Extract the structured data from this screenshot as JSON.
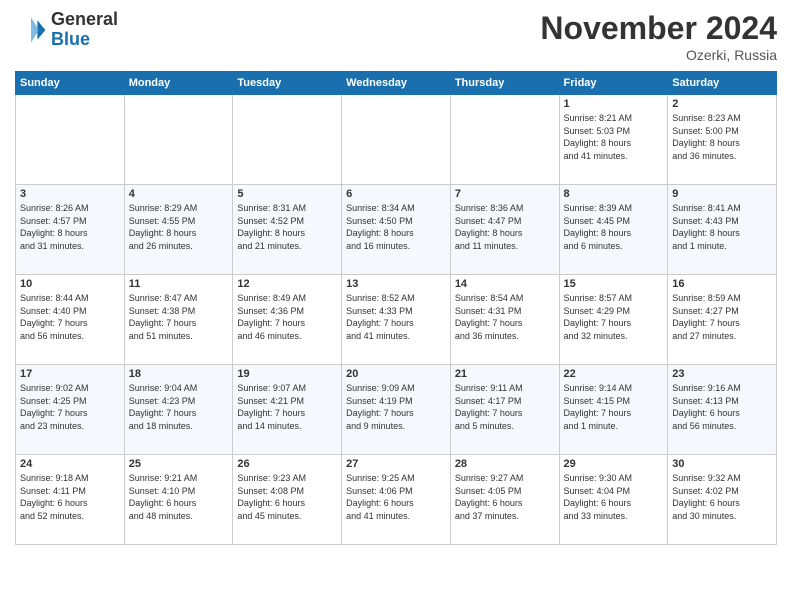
{
  "header": {
    "logo": {
      "general": "General",
      "blue": "Blue"
    },
    "title": "November 2024",
    "location": "Ozerki, Russia"
  },
  "weekdays": [
    "Sunday",
    "Monday",
    "Tuesday",
    "Wednesday",
    "Thursday",
    "Friday",
    "Saturday"
  ],
  "weeks": [
    {
      "days": [
        {
          "num": "",
          "info": ""
        },
        {
          "num": "",
          "info": ""
        },
        {
          "num": "",
          "info": ""
        },
        {
          "num": "",
          "info": ""
        },
        {
          "num": "",
          "info": ""
        },
        {
          "num": "1",
          "info": "Sunrise: 8:21 AM\nSunset: 5:03 PM\nDaylight: 8 hours\nand 41 minutes."
        },
        {
          "num": "2",
          "info": "Sunrise: 8:23 AM\nSunset: 5:00 PM\nDaylight: 8 hours\nand 36 minutes."
        }
      ]
    },
    {
      "days": [
        {
          "num": "3",
          "info": "Sunrise: 8:26 AM\nSunset: 4:57 PM\nDaylight: 8 hours\nand 31 minutes."
        },
        {
          "num": "4",
          "info": "Sunrise: 8:29 AM\nSunset: 4:55 PM\nDaylight: 8 hours\nand 26 minutes."
        },
        {
          "num": "5",
          "info": "Sunrise: 8:31 AM\nSunset: 4:52 PM\nDaylight: 8 hours\nand 21 minutes."
        },
        {
          "num": "6",
          "info": "Sunrise: 8:34 AM\nSunset: 4:50 PM\nDaylight: 8 hours\nand 16 minutes."
        },
        {
          "num": "7",
          "info": "Sunrise: 8:36 AM\nSunset: 4:47 PM\nDaylight: 8 hours\nand 11 minutes."
        },
        {
          "num": "8",
          "info": "Sunrise: 8:39 AM\nSunset: 4:45 PM\nDaylight: 8 hours\nand 6 minutes."
        },
        {
          "num": "9",
          "info": "Sunrise: 8:41 AM\nSunset: 4:43 PM\nDaylight: 8 hours\nand 1 minute."
        }
      ]
    },
    {
      "days": [
        {
          "num": "10",
          "info": "Sunrise: 8:44 AM\nSunset: 4:40 PM\nDaylight: 7 hours\nand 56 minutes."
        },
        {
          "num": "11",
          "info": "Sunrise: 8:47 AM\nSunset: 4:38 PM\nDaylight: 7 hours\nand 51 minutes."
        },
        {
          "num": "12",
          "info": "Sunrise: 8:49 AM\nSunset: 4:36 PM\nDaylight: 7 hours\nand 46 minutes."
        },
        {
          "num": "13",
          "info": "Sunrise: 8:52 AM\nSunset: 4:33 PM\nDaylight: 7 hours\nand 41 minutes."
        },
        {
          "num": "14",
          "info": "Sunrise: 8:54 AM\nSunset: 4:31 PM\nDaylight: 7 hours\nand 36 minutes."
        },
        {
          "num": "15",
          "info": "Sunrise: 8:57 AM\nSunset: 4:29 PM\nDaylight: 7 hours\nand 32 minutes."
        },
        {
          "num": "16",
          "info": "Sunrise: 8:59 AM\nSunset: 4:27 PM\nDaylight: 7 hours\nand 27 minutes."
        }
      ]
    },
    {
      "days": [
        {
          "num": "17",
          "info": "Sunrise: 9:02 AM\nSunset: 4:25 PM\nDaylight: 7 hours\nand 23 minutes."
        },
        {
          "num": "18",
          "info": "Sunrise: 9:04 AM\nSunset: 4:23 PM\nDaylight: 7 hours\nand 18 minutes."
        },
        {
          "num": "19",
          "info": "Sunrise: 9:07 AM\nSunset: 4:21 PM\nDaylight: 7 hours\nand 14 minutes."
        },
        {
          "num": "20",
          "info": "Sunrise: 9:09 AM\nSunset: 4:19 PM\nDaylight: 7 hours\nand 9 minutes."
        },
        {
          "num": "21",
          "info": "Sunrise: 9:11 AM\nSunset: 4:17 PM\nDaylight: 7 hours\nand 5 minutes."
        },
        {
          "num": "22",
          "info": "Sunrise: 9:14 AM\nSunset: 4:15 PM\nDaylight: 7 hours\nand 1 minute."
        },
        {
          "num": "23",
          "info": "Sunrise: 9:16 AM\nSunset: 4:13 PM\nDaylight: 6 hours\nand 56 minutes."
        }
      ]
    },
    {
      "days": [
        {
          "num": "24",
          "info": "Sunrise: 9:18 AM\nSunset: 4:11 PM\nDaylight: 6 hours\nand 52 minutes."
        },
        {
          "num": "25",
          "info": "Sunrise: 9:21 AM\nSunset: 4:10 PM\nDaylight: 6 hours\nand 48 minutes."
        },
        {
          "num": "26",
          "info": "Sunrise: 9:23 AM\nSunset: 4:08 PM\nDaylight: 6 hours\nand 45 minutes."
        },
        {
          "num": "27",
          "info": "Sunrise: 9:25 AM\nSunset: 4:06 PM\nDaylight: 6 hours\nand 41 minutes."
        },
        {
          "num": "28",
          "info": "Sunrise: 9:27 AM\nSunset: 4:05 PM\nDaylight: 6 hours\nand 37 minutes."
        },
        {
          "num": "29",
          "info": "Sunrise: 9:30 AM\nSunset: 4:04 PM\nDaylight: 6 hours\nand 33 minutes."
        },
        {
          "num": "30",
          "info": "Sunrise: 9:32 AM\nSunset: 4:02 PM\nDaylight: 6 hours\nand 30 minutes."
        }
      ]
    }
  ]
}
